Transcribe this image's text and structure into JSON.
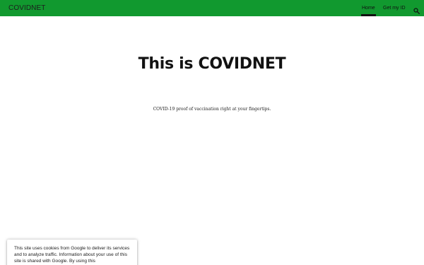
{
  "header": {
    "site_title": "COVIDNET",
    "nav": [
      {
        "label": "Home",
        "active": true
      },
      {
        "label": "Get my ID"
      }
    ],
    "search_icon": "search-icon",
    "background_color": "#11992f"
  },
  "main": {
    "title": "This is COVIDNET",
    "subtitle": "COVID-19 proof of vaccination right at your fingertips."
  },
  "cookie_notice": {
    "text": "This site uses cookies from Google to deliver its services and to analyze traffic. Information about your use of this site is shared with Google. By using this"
  }
}
